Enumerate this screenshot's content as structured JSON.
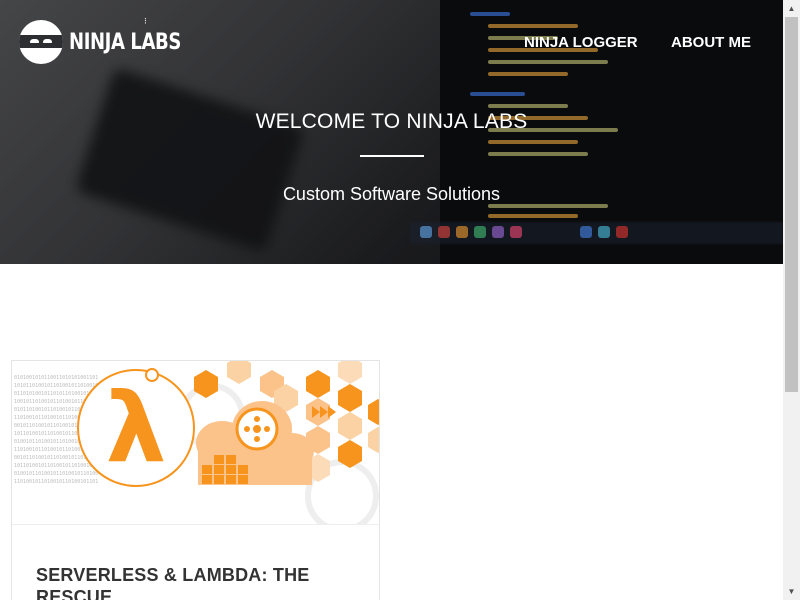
{
  "brand": {
    "name": "NINJA LABS"
  },
  "nav": {
    "items": [
      {
        "label": "NINJA LOGGER"
      },
      {
        "label": "ABOUT ME"
      }
    ]
  },
  "hero": {
    "title": "WELCOME TO NINJA LABS",
    "subtitle": "Custom Software Solutions"
  },
  "posts": [
    {
      "title": "SERVERLESS & LAMBDA: THE RESCUE"
    }
  ],
  "colors": {
    "accent_orange": "#f7941d",
    "text_dark": "#333333",
    "hero_text": "#ffffff"
  },
  "icons": {
    "logo": "ninja-head-icon",
    "lambda": "lambda-icon",
    "scroll_up": "chevron-up-icon",
    "scroll_down": "chevron-down-icon"
  }
}
